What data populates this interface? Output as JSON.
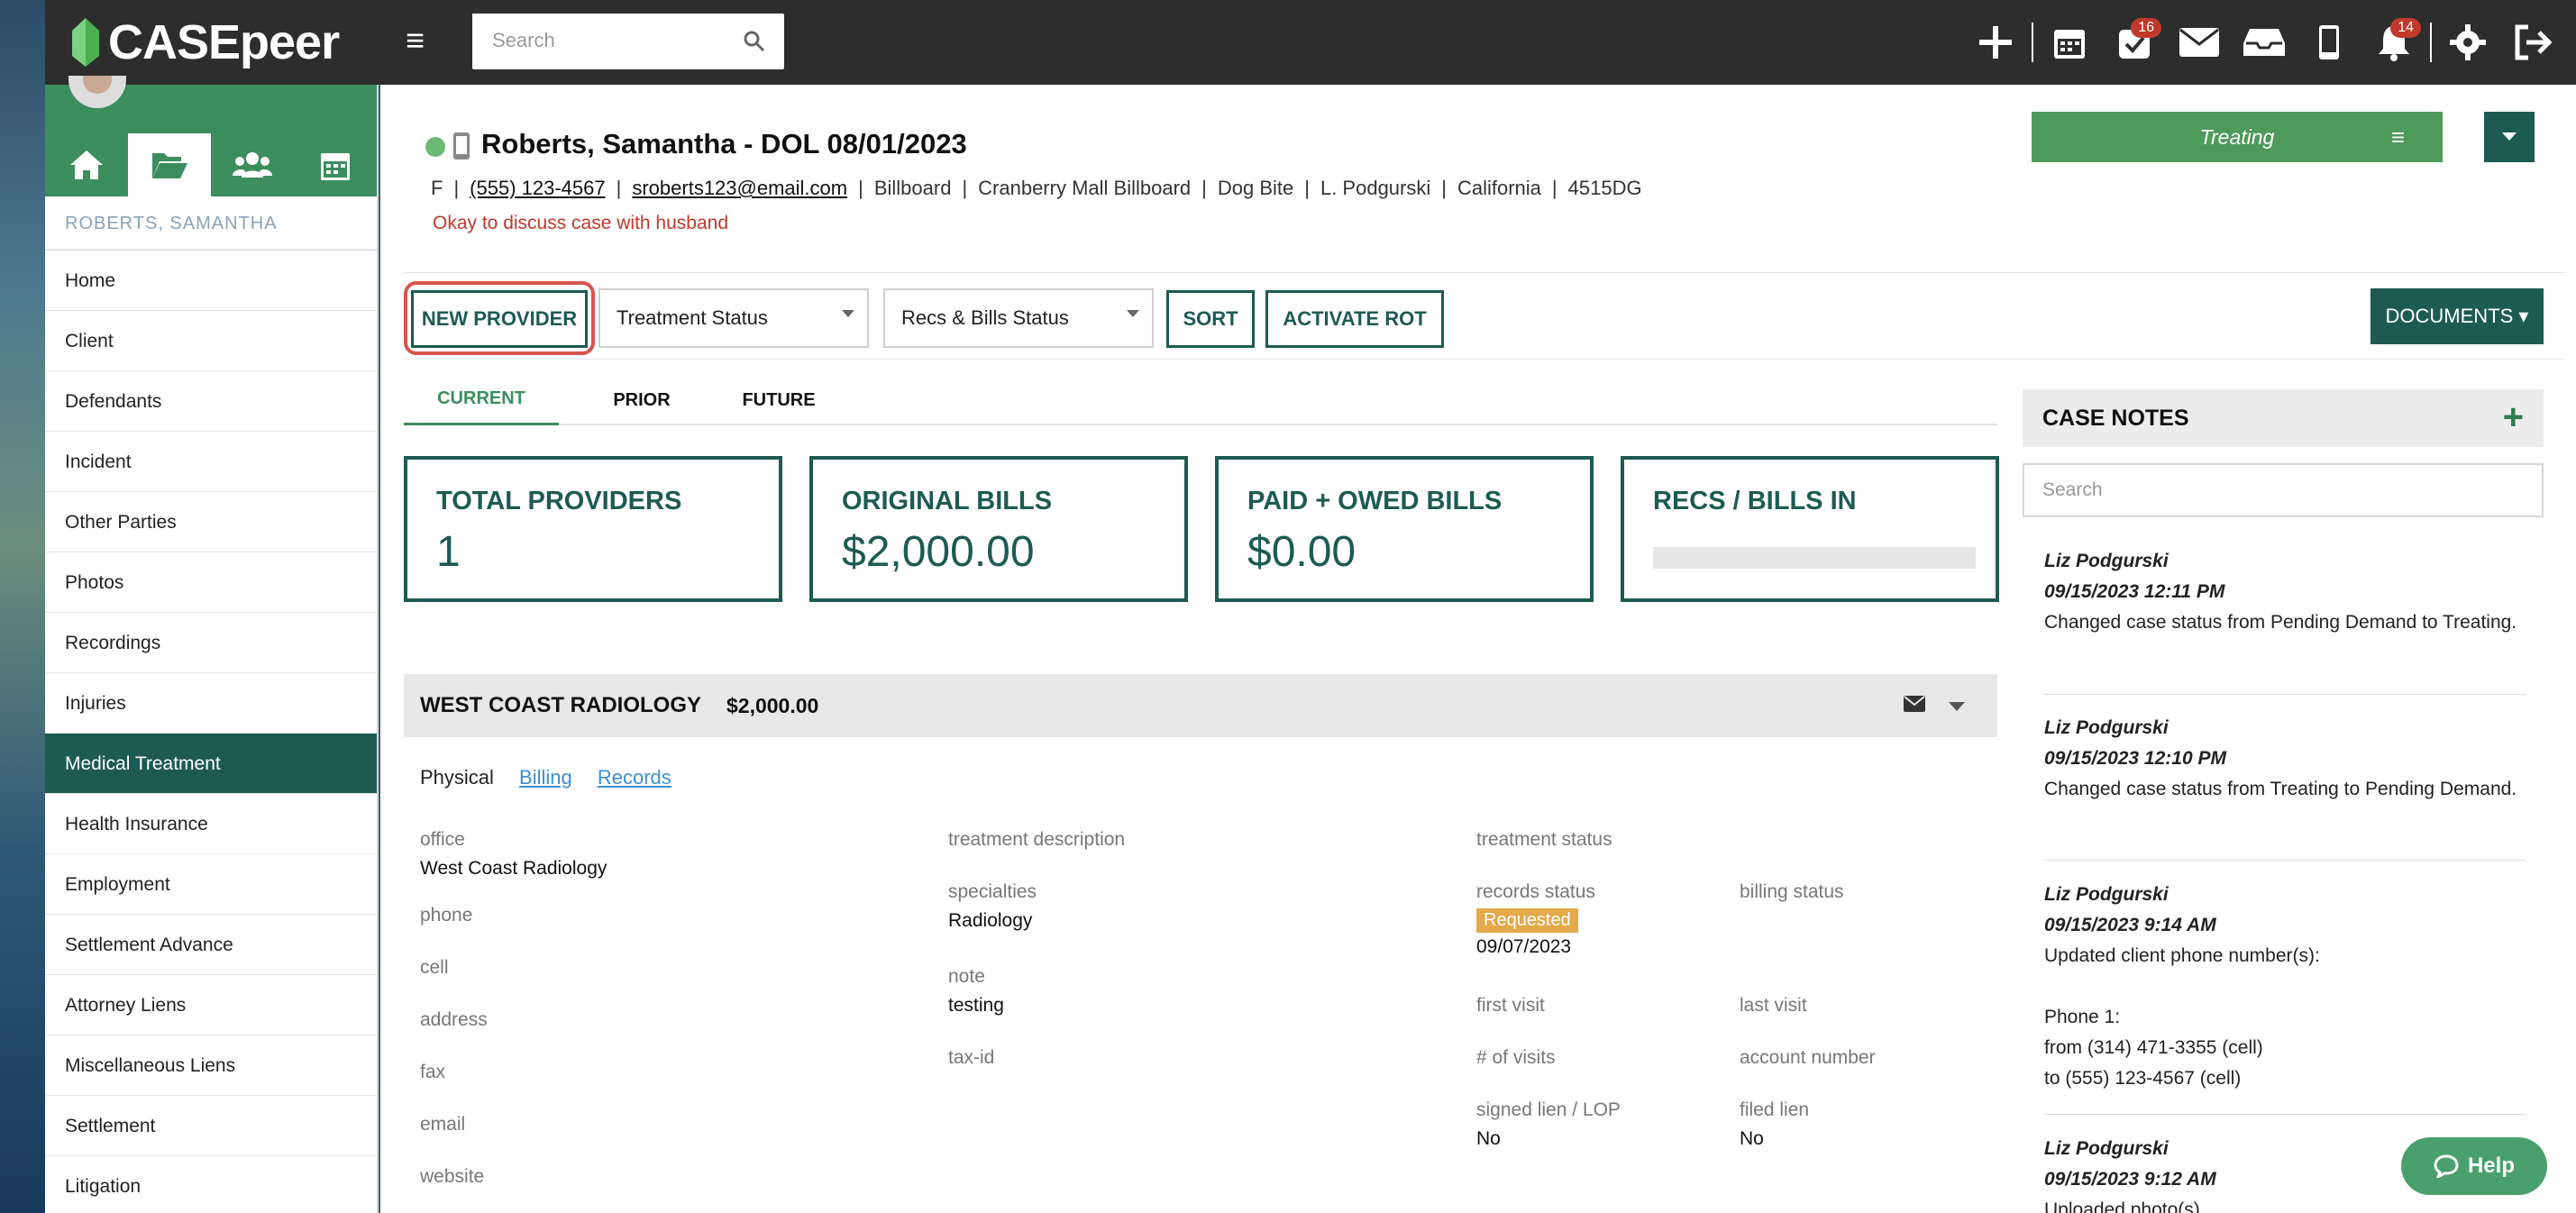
{
  "app": {
    "name": "CASEpeer"
  },
  "topbar": {
    "search_placeholder": "Search",
    "tasks_badge": "16",
    "notifications_badge": "14"
  },
  "sidebar": {
    "client_label": "ROBERTS, SAMANTHA",
    "items": [
      {
        "label": "Home"
      },
      {
        "label": "Client"
      },
      {
        "label": "Defendants"
      },
      {
        "label": "Incident"
      },
      {
        "label": "Other Parties"
      },
      {
        "label": "Photos"
      },
      {
        "label": "Recordings"
      },
      {
        "label": "Injuries"
      },
      {
        "label": "Medical Treatment",
        "active": true
      },
      {
        "label": "Health Insurance"
      },
      {
        "label": "Employment"
      },
      {
        "label": "Settlement Advance"
      },
      {
        "label": "Attorney Liens"
      },
      {
        "label": "Miscellaneous Liens"
      },
      {
        "label": "Settlement"
      },
      {
        "label": "Litigation"
      }
    ]
  },
  "case": {
    "title": "Roberts, Samantha - DOL 08/01/2023",
    "gender": "F",
    "phone": "(555) 123-4567",
    "email": "sroberts123@email.com",
    "source": "Billboard",
    "source_detail": "Cranberry Mall Billboard",
    "case_type": "Dog Bite",
    "attorney": "L. Podgurski",
    "state": "California",
    "case_id": "4515DG",
    "alert": "Okay to discuss case with husband",
    "status": "Treating"
  },
  "toolbar": {
    "new_provider": "NEW PROVIDER",
    "treatment_status": "Treatment Status",
    "recs_bills_status": "Recs & Bills Status",
    "sort": "SORT",
    "activate_rot": "ACTIVATE ROT",
    "documents": "DOCUMENTS ▾"
  },
  "tabs": {
    "current": "CURRENT",
    "prior": "PRIOR",
    "future": "FUTURE"
  },
  "stats": {
    "total_providers": {
      "label": "TOTAL PROVIDERS",
      "value": "1"
    },
    "original_bills": {
      "label": "ORIGINAL BILLS",
      "value": "$2,000.00"
    },
    "paid_owed": {
      "label": "PAID + OWED BILLS",
      "value": "$0.00"
    },
    "recs_bills_in": {
      "label": "RECS / BILLS IN",
      "progress": 0
    }
  },
  "provider": {
    "name": "WEST COAST RADIOLOGY",
    "amount": "$2,000.00",
    "subtabs": {
      "physical": "Physical",
      "billing": "Billing",
      "records": "Records"
    },
    "fields": {
      "office_k": "office",
      "office_v": "West Coast Radiology",
      "phone_k": "phone",
      "cell_k": "cell",
      "address_k": "address",
      "fax_k": "fax",
      "email_k": "email",
      "website_k": "website",
      "treatment_desc_k": "treatment description",
      "specialties_k": "specialties",
      "specialties_v": "Radiology",
      "note_k": "note",
      "note_v": "testing",
      "taxid_k": "tax-id",
      "treatment_status_k": "treatment status",
      "records_status_k": "records status",
      "records_status_v": "Requested",
      "records_date": "09/07/2023",
      "billing_status_k": "billing status",
      "first_visit_k": "first visit",
      "last_visit_k": "last visit",
      "visits_k": "# of visits",
      "account_k": "account number",
      "signed_lien_k": "signed lien / LOP",
      "signed_lien_v": "No",
      "filed_lien_k": "filed lien",
      "filed_lien_v": "No"
    }
  },
  "case_notes": {
    "title": "CASE NOTES",
    "search_placeholder": "Search",
    "notes": [
      {
        "author": "Liz Podgurski",
        "date": "09/15/2023 12:11 PM",
        "text": "Changed case status from Pending Demand to Treating."
      },
      {
        "author": "Liz Podgurski",
        "date": "09/15/2023 12:10 PM",
        "text": "Changed case status from Treating to Pending Demand."
      },
      {
        "author": "Liz Podgurski",
        "date": "09/15/2023 9:14 AM",
        "text": "Updated client phone number(s):",
        "line2": "Phone 1:",
        "line3": "from (314) 471-3355 (cell)",
        "line4": "to (555) 123-4567 (cell)"
      },
      {
        "author": "Liz Podgurski",
        "date": "09/15/2023 9:12 AM",
        "text": "Uploaded photo(s)."
      }
    ]
  },
  "help": {
    "label": "Help"
  },
  "colors": {
    "brand_dark": "#1d5b52",
    "brand_green": "#3d8e5e",
    "treating": "#4e9a5b",
    "alert": "#c0392b",
    "pill": "#e4a94a"
  }
}
